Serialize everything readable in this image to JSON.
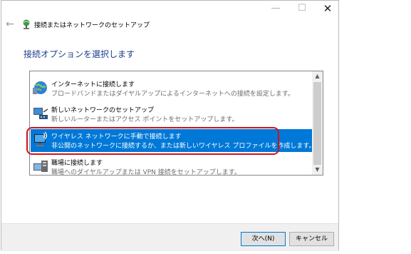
{
  "titlebar": {
    "minimize": "—",
    "maximize": "☐",
    "close": "✕"
  },
  "header": {
    "back": "←",
    "title": "接続またはネットワークのセットアップ"
  },
  "heading": "接続オプションを選択します",
  "options": [
    {
      "title": "インターネットに接続します",
      "desc": "ブロードバンドまたはダイヤルアップによるインターネットへの接続を設定します。",
      "icon": "globe-icon"
    },
    {
      "title": "新しいネットワークのセットアップ",
      "desc": "新しいルーターまたはアクセス ポイントをセットアップします。",
      "icon": "router-icon"
    },
    {
      "title": "ワイヤレス ネットワークに手動で接続します",
      "desc": "非公開のネットワークに接続するか、または新しいワイヤレス プロファイルを作成します。",
      "icon": "wireless-monitor-icon",
      "selected": true
    },
    {
      "title": "職場に接続します",
      "desc": "職場へのダイヤルアップまたは VPN 接続をセットアップします。",
      "icon": "workplace-icon"
    }
  ],
  "scrollbar": {
    "up": "▲",
    "down": "▼"
  },
  "buttons": {
    "next": "次へ(N)",
    "cancel": "キャンセル"
  },
  "colors": {
    "selection": "#0078d7",
    "highlight_border": "#d0121b",
    "heading": "#1e3e8c"
  }
}
